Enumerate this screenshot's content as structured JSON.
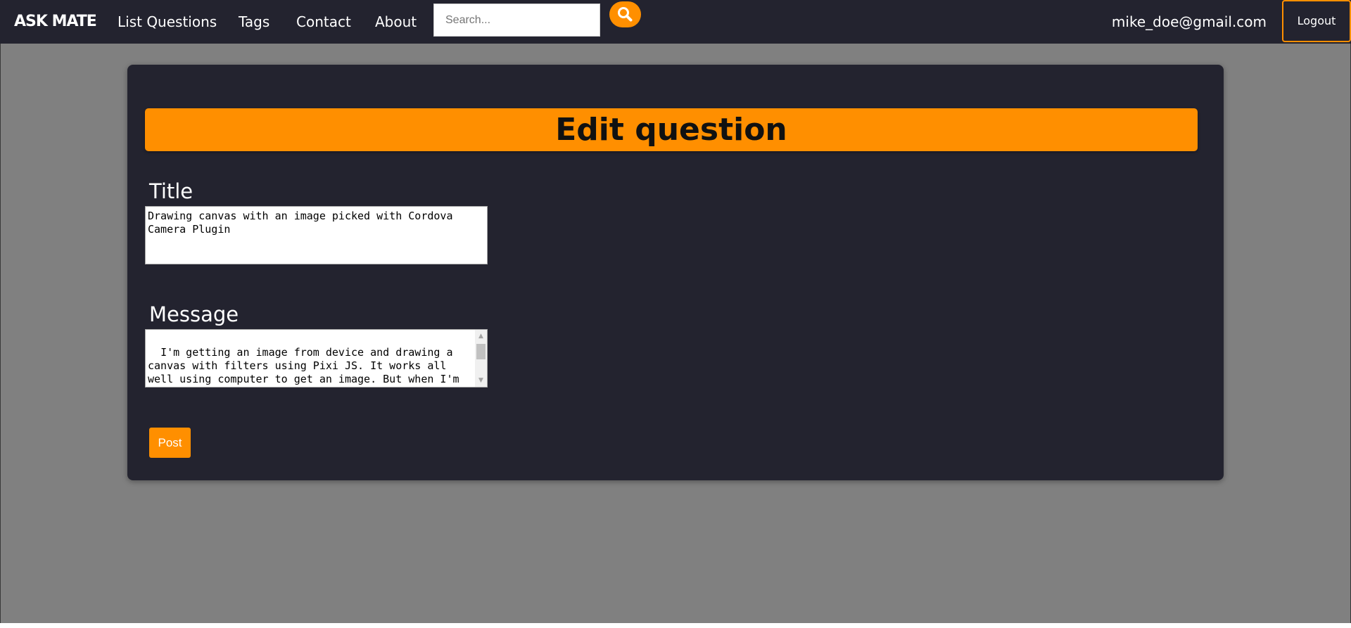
{
  "nav": {
    "logo": "ASK MATE",
    "links": [
      "List Questions",
      "Tags",
      "Contact",
      "About"
    ],
    "search_placeholder": "Search...",
    "search_icon": "magnifier-icon",
    "user_email": "mike_doe@gmail.com",
    "logout_label": "Logout"
  },
  "form": {
    "heading": "Edit question",
    "title_label": "Title",
    "title_value": "Drawing canvas with an image picked with Cordova Camera Plugin",
    "message_label": "Message",
    "message_value": "I'm getting an image from device and drawing a canvas with filters using Pixi JS. It works all well using computer to get an image. But when I'm on IOS, it throws errors such as cross origin issue, or that I'm trying to use an unknown format.",
    "post_label": "Post"
  },
  "colors": {
    "accent": "#ff8f00",
    "navbar_bg": "#23232f",
    "card_bg": "#23232f",
    "page_bg": "#808080"
  }
}
